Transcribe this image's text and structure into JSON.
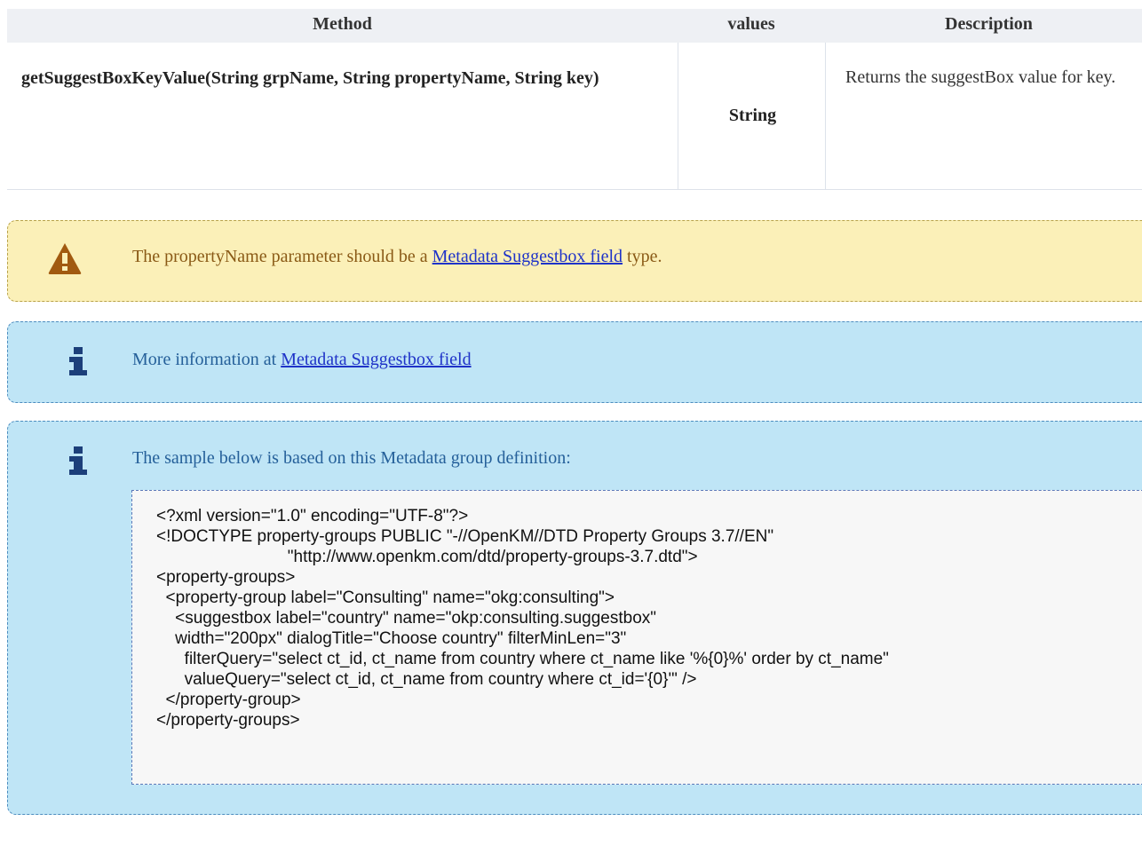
{
  "table": {
    "headers": {
      "method": "Method",
      "values": "values",
      "description": "Description"
    },
    "rows": [
      {
        "method": "getSuggestBoxKeyValue(String grpName, String propertyName, String key)",
        "values": "String",
        "description": "Returns the suggestBox value for key."
      }
    ]
  },
  "warning": {
    "icon": "warning-icon",
    "text_before": "The propertyName parameter should be a ",
    "link_text": "Metadata Suggestbox field",
    "text_after": " type."
  },
  "info_more": {
    "icon": "info-icon",
    "text_before": "More information at ",
    "link_text": "Metadata Suggestbox field"
  },
  "info_sample": {
    "icon": "info-icon",
    "text": "The sample below is based on this Metadata group definition:",
    "code": "<?xml version=\"1.0\" encoding=\"UTF-8\"?>\n<!DOCTYPE property-groups PUBLIC \"-//OpenKM//DTD Property Groups 3.7//EN\"\n                            \"http://www.openkm.com/dtd/property-groups-3.7.dtd\">\n<property-groups>\n  <property-group label=\"Consulting\" name=\"okg:consulting\">\n    <suggestbox label=\"country\" name=\"okp:consulting.suggestbox\"\n    width=\"200px\" dialogTitle=\"Choose country\" filterMinLen=\"3\"\n      filterQuery=\"select ct_id, ct_name from country where ct_name like '%{0}%' order by ct_name\"\n      valueQuery=\"select ct_id, ct_name from country where ct_id='{0}'\" />\n  </property-group>\n</property-groups>"
  },
  "colors": {
    "warning_bg": "#fbf0b8",
    "warning_text": "#8a5a16",
    "info_bg": "#bfe5f6",
    "info_text": "#25609a",
    "link": "#1f33c8",
    "table_header_bg": "#eef0f4"
  }
}
